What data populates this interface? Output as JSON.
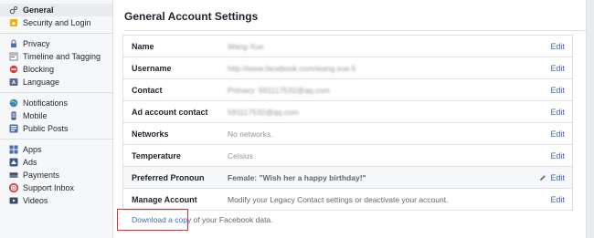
{
  "sidebar": {
    "groups": [
      [
        {
          "label": "General",
          "icon": "gear-icon",
          "active": true
        },
        {
          "label": "Security and Login",
          "icon": "lock-shield-icon"
        }
      ],
      [
        {
          "label": "Privacy",
          "icon": "privacy-lock-icon"
        },
        {
          "label": "Timeline and Tagging",
          "icon": "timeline-icon"
        },
        {
          "label": "Blocking",
          "icon": "blocking-icon"
        },
        {
          "label": "Language",
          "icon": "language-icon"
        }
      ],
      [
        {
          "label": "Notifications",
          "icon": "globe-icon"
        },
        {
          "label": "Mobile",
          "icon": "mobile-icon"
        },
        {
          "label": "Public Posts",
          "icon": "rss-icon"
        }
      ],
      [
        {
          "label": "Apps",
          "icon": "apps-icon"
        },
        {
          "label": "Ads",
          "icon": "ads-icon"
        },
        {
          "label": "Payments",
          "icon": "payments-icon"
        },
        {
          "label": "Support Inbox",
          "icon": "lifebuoy-icon"
        },
        {
          "label": "Videos",
          "icon": "video-icon"
        }
      ]
    ]
  },
  "main": {
    "title": "General Account Settings",
    "rows": [
      {
        "label": "Name",
        "value": "Wang Xue",
        "edit": "Edit",
        "style": "blur"
      },
      {
        "label": "Username",
        "value": "http://www.facebook.com/wang.xue.5",
        "edit": "Edit",
        "style": "blur"
      },
      {
        "label": "Contact",
        "value": "Primary: 591117532@qq.com",
        "edit": "Edit",
        "style": "blur"
      },
      {
        "label": "Ad account contact",
        "value": "591117532@qq.com",
        "edit": "Edit",
        "style": "blur"
      },
      {
        "label": "Networks",
        "value": "No networks.",
        "edit": "Edit",
        "style": "plain"
      },
      {
        "label": "Temperature",
        "value": "Celsius",
        "edit": "Edit",
        "style": "plain"
      },
      {
        "label": "Preferred Pronoun",
        "value": "Female: \"Wish her a happy birthday!\"",
        "edit": "Edit",
        "style": "bold",
        "highlight": true,
        "pencil": true
      },
      {
        "label": "Manage Account",
        "value": "Modify your Legacy Contact settings or deactivate your account.",
        "edit": "Edit",
        "style": "dark"
      }
    ],
    "download": {
      "link": "Download a copy",
      "rest": " of your Facebook data."
    }
  },
  "colors": {
    "link": "#4267b2",
    "highlight_box": "#e3332f",
    "sidebar_bg": "#f6f7f9"
  }
}
